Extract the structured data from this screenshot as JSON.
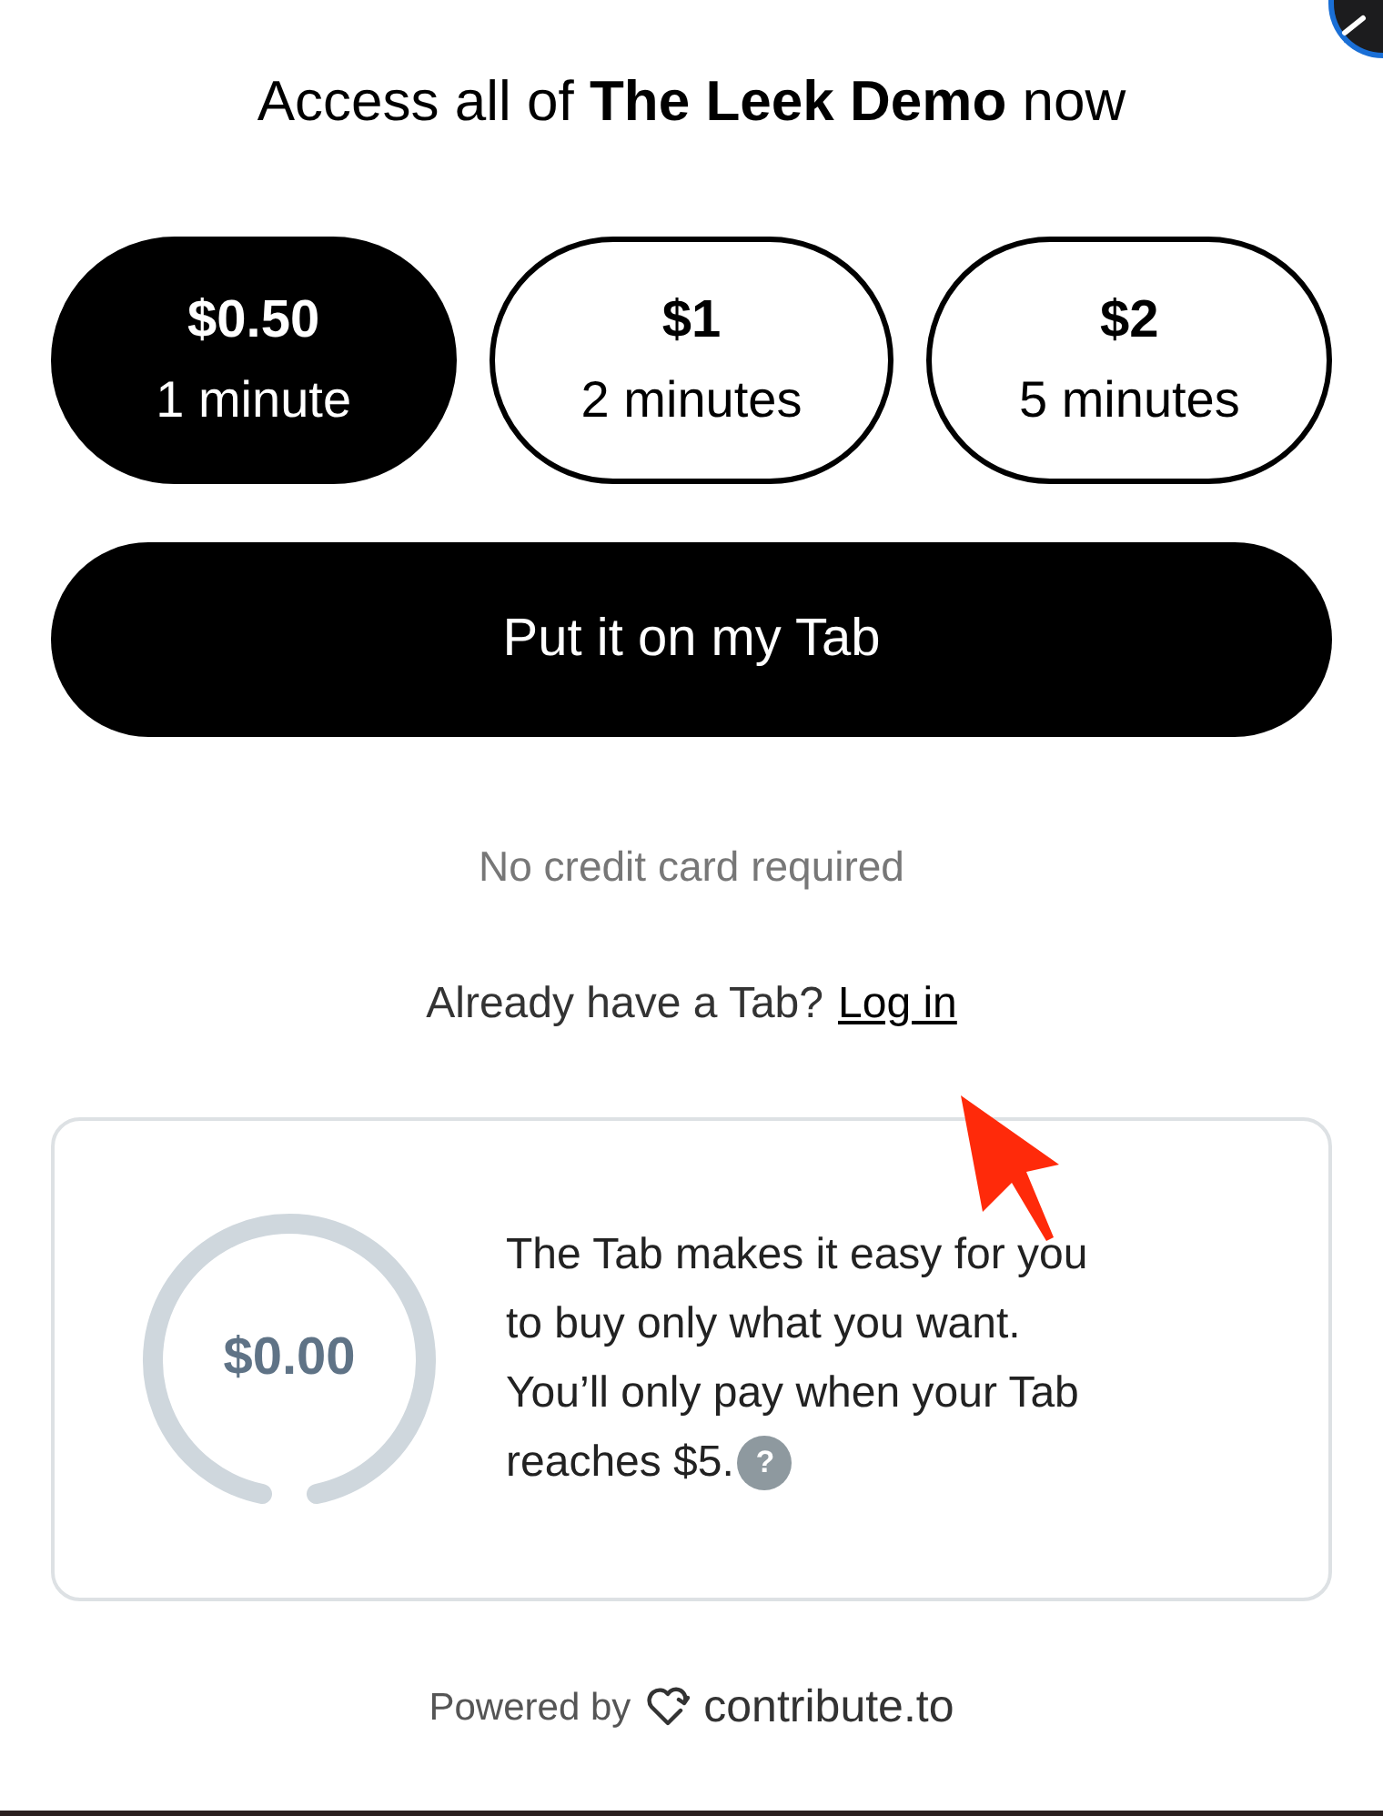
{
  "title": "Access all of **The Leek Demo** now",
  "options": [
    {
      "price": "$0.50",
      "duration": "1 minute",
      "selected": true
    },
    {
      "price": "$1",
      "duration": "2 minutes",
      "selected": false
    },
    {
      "price": "$2",
      "duration": "5 minutes",
      "selected": false
    }
  ],
  "primary_button": "Put it on my Tab",
  "note": "No credit card required",
  "login_prompt": {
    "text": "Already have a Tab?",
    "link": "Log in"
  },
  "tab_card": {
    "balance": "$0.00",
    "description_lines": [
      "The Tab makes it easy for you",
      "to buy only what you want.",
      "You’ll only pay when your Tab",
      "reaches $5."
    ],
    "help_glyph": "?"
  },
  "footer": {
    "text": "Powered by",
    "brand": "contribute.to"
  }
}
